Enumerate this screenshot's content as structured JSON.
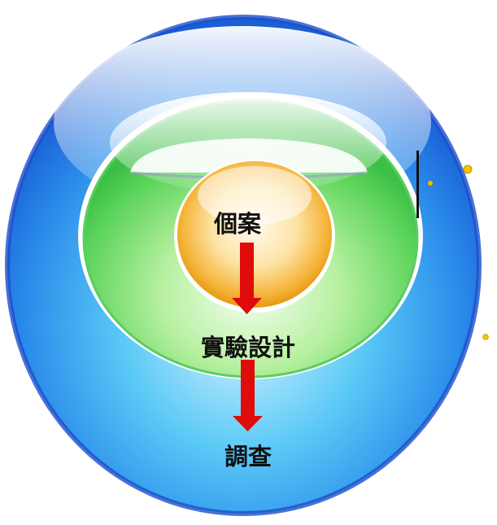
{
  "diagram": {
    "levels": [
      {
        "id": "case",
        "label": "個案"
      },
      {
        "id": "experimental-design",
        "label": "實驗設計"
      },
      {
        "id": "survey",
        "label": "調查"
      }
    ],
    "colors": {
      "outer_blue": "#1f73e0",
      "outer_blue_light": "#45c4f5",
      "middle_green": "#58d858",
      "inner_orange": "#f2a81e",
      "arrow_red": "#e00b0b",
      "dot_yellow": "#f7c300"
    }
  }
}
